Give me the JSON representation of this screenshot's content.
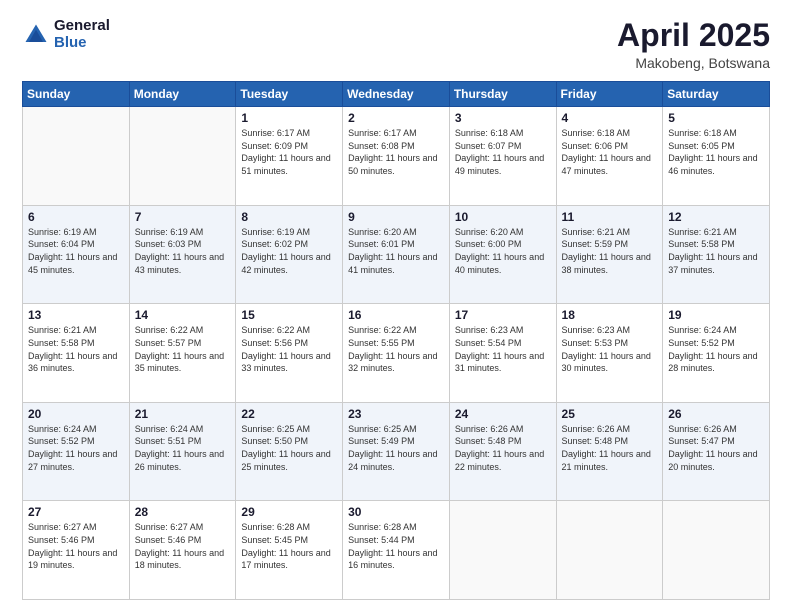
{
  "logo": {
    "general": "General",
    "blue": "Blue"
  },
  "title": {
    "month": "April 2025",
    "location": "Makobeng, Botswana"
  },
  "weekdays": [
    "Sunday",
    "Monday",
    "Tuesday",
    "Wednesday",
    "Thursday",
    "Friday",
    "Saturday"
  ],
  "weeks": [
    [
      {
        "day": "",
        "info": ""
      },
      {
        "day": "",
        "info": ""
      },
      {
        "day": "1",
        "info": "Sunrise: 6:17 AM\nSunset: 6:09 PM\nDaylight: 11 hours and 51 minutes."
      },
      {
        "day": "2",
        "info": "Sunrise: 6:17 AM\nSunset: 6:08 PM\nDaylight: 11 hours and 50 minutes."
      },
      {
        "day": "3",
        "info": "Sunrise: 6:18 AM\nSunset: 6:07 PM\nDaylight: 11 hours and 49 minutes."
      },
      {
        "day": "4",
        "info": "Sunrise: 6:18 AM\nSunset: 6:06 PM\nDaylight: 11 hours and 47 minutes."
      },
      {
        "day": "5",
        "info": "Sunrise: 6:18 AM\nSunset: 6:05 PM\nDaylight: 11 hours and 46 minutes."
      }
    ],
    [
      {
        "day": "6",
        "info": "Sunrise: 6:19 AM\nSunset: 6:04 PM\nDaylight: 11 hours and 45 minutes."
      },
      {
        "day": "7",
        "info": "Sunrise: 6:19 AM\nSunset: 6:03 PM\nDaylight: 11 hours and 43 minutes."
      },
      {
        "day": "8",
        "info": "Sunrise: 6:19 AM\nSunset: 6:02 PM\nDaylight: 11 hours and 42 minutes."
      },
      {
        "day": "9",
        "info": "Sunrise: 6:20 AM\nSunset: 6:01 PM\nDaylight: 11 hours and 41 minutes."
      },
      {
        "day": "10",
        "info": "Sunrise: 6:20 AM\nSunset: 6:00 PM\nDaylight: 11 hours and 40 minutes."
      },
      {
        "day": "11",
        "info": "Sunrise: 6:21 AM\nSunset: 5:59 PM\nDaylight: 11 hours and 38 minutes."
      },
      {
        "day": "12",
        "info": "Sunrise: 6:21 AM\nSunset: 5:58 PM\nDaylight: 11 hours and 37 minutes."
      }
    ],
    [
      {
        "day": "13",
        "info": "Sunrise: 6:21 AM\nSunset: 5:58 PM\nDaylight: 11 hours and 36 minutes."
      },
      {
        "day": "14",
        "info": "Sunrise: 6:22 AM\nSunset: 5:57 PM\nDaylight: 11 hours and 35 minutes."
      },
      {
        "day": "15",
        "info": "Sunrise: 6:22 AM\nSunset: 5:56 PM\nDaylight: 11 hours and 33 minutes."
      },
      {
        "day": "16",
        "info": "Sunrise: 6:22 AM\nSunset: 5:55 PM\nDaylight: 11 hours and 32 minutes."
      },
      {
        "day": "17",
        "info": "Sunrise: 6:23 AM\nSunset: 5:54 PM\nDaylight: 11 hours and 31 minutes."
      },
      {
        "day": "18",
        "info": "Sunrise: 6:23 AM\nSunset: 5:53 PM\nDaylight: 11 hours and 30 minutes."
      },
      {
        "day": "19",
        "info": "Sunrise: 6:24 AM\nSunset: 5:52 PM\nDaylight: 11 hours and 28 minutes."
      }
    ],
    [
      {
        "day": "20",
        "info": "Sunrise: 6:24 AM\nSunset: 5:52 PM\nDaylight: 11 hours and 27 minutes."
      },
      {
        "day": "21",
        "info": "Sunrise: 6:24 AM\nSunset: 5:51 PM\nDaylight: 11 hours and 26 minutes."
      },
      {
        "day": "22",
        "info": "Sunrise: 6:25 AM\nSunset: 5:50 PM\nDaylight: 11 hours and 25 minutes."
      },
      {
        "day": "23",
        "info": "Sunrise: 6:25 AM\nSunset: 5:49 PM\nDaylight: 11 hours and 24 minutes."
      },
      {
        "day": "24",
        "info": "Sunrise: 6:26 AM\nSunset: 5:48 PM\nDaylight: 11 hours and 22 minutes."
      },
      {
        "day": "25",
        "info": "Sunrise: 6:26 AM\nSunset: 5:48 PM\nDaylight: 11 hours and 21 minutes."
      },
      {
        "day": "26",
        "info": "Sunrise: 6:26 AM\nSunset: 5:47 PM\nDaylight: 11 hours and 20 minutes."
      }
    ],
    [
      {
        "day": "27",
        "info": "Sunrise: 6:27 AM\nSunset: 5:46 PM\nDaylight: 11 hours and 19 minutes."
      },
      {
        "day": "28",
        "info": "Sunrise: 6:27 AM\nSunset: 5:46 PM\nDaylight: 11 hours and 18 minutes."
      },
      {
        "day": "29",
        "info": "Sunrise: 6:28 AM\nSunset: 5:45 PM\nDaylight: 11 hours and 17 minutes."
      },
      {
        "day": "30",
        "info": "Sunrise: 6:28 AM\nSunset: 5:44 PM\nDaylight: 11 hours and 16 minutes."
      },
      {
        "day": "",
        "info": ""
      },
      {
        "day": "",
        "info": ""
      },
      {
        "day": "",
        "info": ""
      }
    ]
  ]
}
